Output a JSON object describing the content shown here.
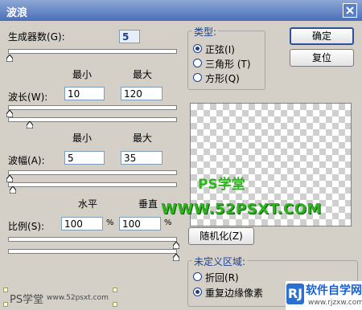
{
  "window": {
    "title": "波浪"
  },
  "generators": {
    "label": "生成器数",
    "key": "(G):",
    "value": "5"
  },
  "col_headers": {
    "min": "最小",
    "max": "最大"
  },
  "wavelength": {
    "label": "波长",
    "key": "(W):",
    "min": "10",
    "max": "120"
  },
  "col_headers_2": {
    "min": "最小",
    "max": "最大"
  },
  "amplitude": {
    "label": "波幅",
    "key": "(A):",
    "min": "5",
    "max": "35"
  },
  "scale_headers": {
    "horizontal": "水平",
    "vertical": "垂直"
  },
  "scale": {
    "label": "比例",
    "key": "(S):",
    "h": "100",
    "v": "100",
    "unit": "%"
  },
  "type_group": {
    "legend": "类型:",
    "options": [
      {
        "label": "正弦",
        "key": "(I)",
        "selected": true
      },
      {
        "label": "三角形",
        "key": "(T)",
        "selected": false
      },
      {
        "label": "方形",
        "key": "(Q)",
        "selected": false
      }
    ]
  },
  "buttons": {
    "ok": "确定",
    "reset": "复位",
    "randomize": "随机化",
    "randomize_key": "(Z)"
  },
  "undefined_area": {
    "legend": "未定义区域:",
    "options": [
      {
        "label": "折回",
        "key": "(R)",
        "selected": false
      },
      {
        "label": "重复边缘像素",
        "selected": true
      }
    ]
  },
  "watermarks": {
    "ps": "PS学堂",
    "url": "WWW.52PSXT.COM",
    "bottom_left": "PS学堂",
    "bottom_left_url": "www.52psxt.com",
    "rj_logo": "RJ",
    "rj_title": "软件自学网",
    "rj_url": "www.rjzxw.com"
  },
  "colors": {
    "accent": "#1f3f88",
    "watermark": "#2fb31e"
  }
}
